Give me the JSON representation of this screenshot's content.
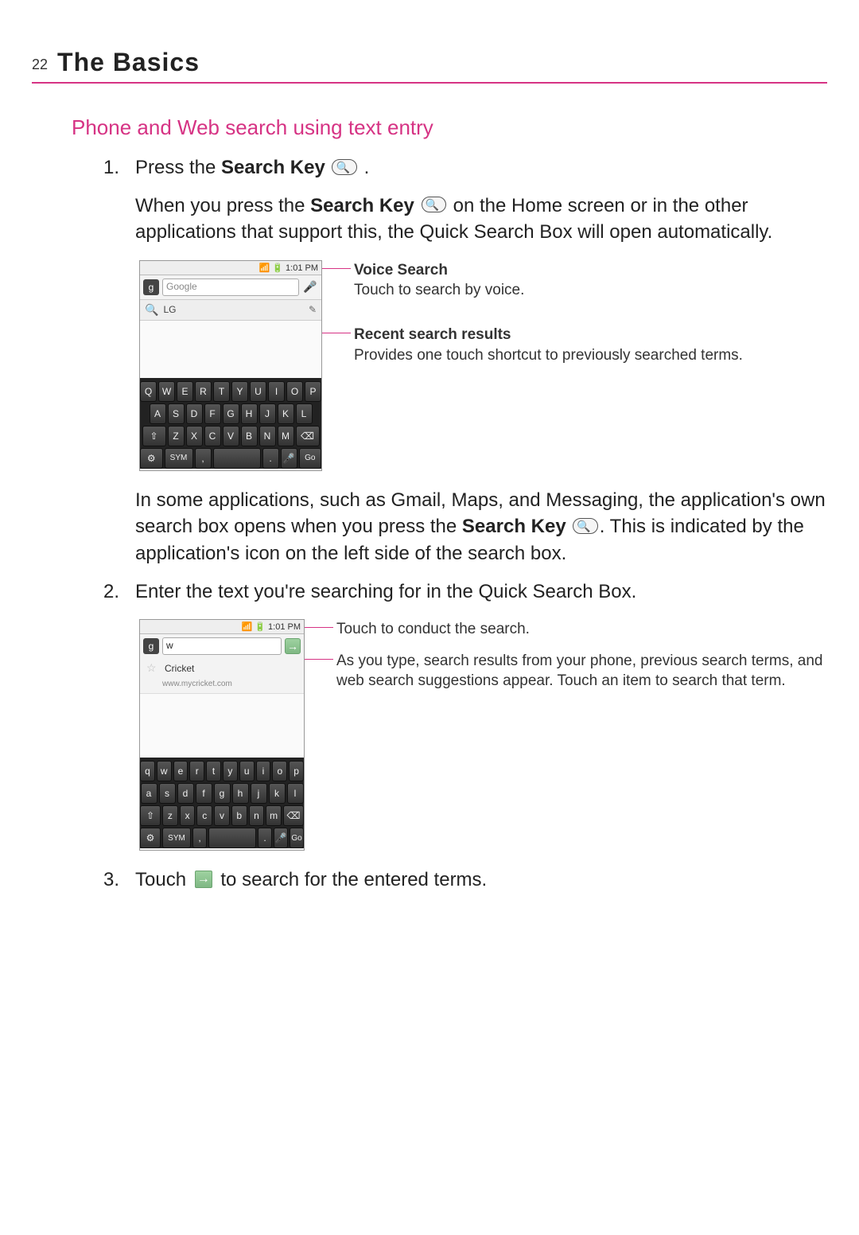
{
  "header": {
    "page_number": "22",
    "title": "The Basics"
  },
  "section": {
    "title": "Phone and Web search using text entry"
  },
  "steps": {
    "s1": {
      "num": "1.",
      "pre": "Press the ",
      "bold": "Search Key",
      "post": " ."
    },
    "p1a": "When you press the ",
    "p1a_bold": "Search Key",
    "p1b": " on the Home screen or in the other applications that support this, the Quick Search Box will open automatically.",
    "p2a": "In some applications, such as Gmail, Maps, and Messaging, the application's own search box opens when you press the ",
    "p2a_bold": "Search Key",
    "p2b": ". This is indicated by the application's icon on the left side of the search box.",
    "s2": {
      "num": "2.",
      "text": "Enter the text you're searching for in the Quick Search Box."
    },
    "s3": {
      "num": "3.",
      "pre": "Touch ",
      "post": " to search for the entered terms."
    }
  },
  "fig1": {
    "status_time": "1:01 PM",
    "search_placeholder": "Google",
    "recent_text": "LG",
    "callouts": {
      "voice_title": "Voice Search",
      "voice_body": "Touch to search by voice.",
      "recent_title": "Recent search results",
      "recent_body": "Provides one touch shortcut to previously searched terms."
    },
    "keys_row1": [
      "Q",
      "W",
      "E",
      "R",
      "T",
      "Y",
      "U",
      "I",
      "O",
      "P"
    ],
    "keys_row2": [
      "A",
      "S",
      "D",
      "F",
      "G",
      "H",
      "J",
      "K",
      "L"
    ],
    "keys_row3": [
      "⇧",
      "Z",
      "X",
      "C",
      "V",
      "B",
      "N",
      "M",
      "⌫"
    ],
    "keys_row4_sym": "SYM",
    "keys_row4_go": "Go"
  },
  "fig2": {
    "status_time": "1:01 PM",
    "search_value": "w",
    "result_title": "Cricket",
    "result_sub": "www.mycricket.com",
    "callouts": {
      "go_text": "Touch to conduct the search.",
      "results_text": "As you type, search results from your phone, previous search terms, and web search suggestions appear. Touch an item to search that term."
    },
    "keys_row1": [
      "q",
      "w",
      "e",
      "r",
      "t",
      "y",
      "u",
      "i",
      "o",
      "p"
    ],
    "keys_row2": [
      "a",
      "s",
      "d",
      "f",
      "g",
      "h",
      "j",
      "k",
      "l"
    ],
    "keys_row3": [
      "⇧",
      "z",
      "x",
      "c",
      "v",
      "b",
      "n",
      "m",
      "⌫"
    ],
    "keys_row4_sym": "SYM",
    "keys_row4_go": "Go"
  }
}
